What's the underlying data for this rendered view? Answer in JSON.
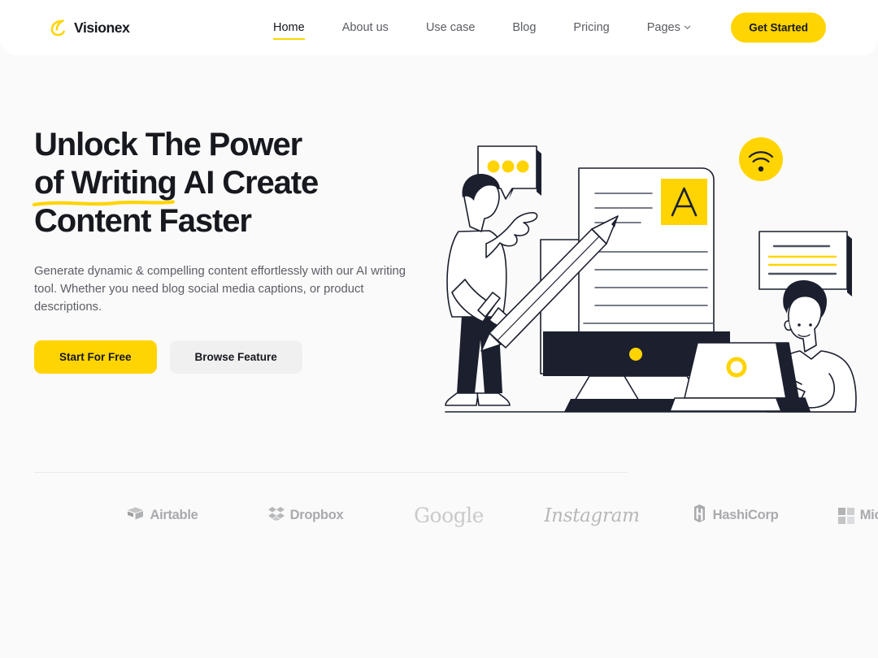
{
  "theme": {
    "accent": "#FFD400",
    "ink": "#17191f",
    "page_bg": "#fafafa",
    "header_bg": "#ffffff",
    "muted_text": "#5c5e66",
    "logo_gray": "#a9aaad"
  },
  "header": {
    "brand_name": "Visionex",
    "brand_icon": "cloud-swoosh-icon",
    "nav": [
      {
        "label": "Home",
        "active": true,
        "has_dropdown": false
      },
      {
        "label": "About us",
        "active": false,
        "has_dropdown": false
      },
      {
        "label": "Use case",
        "active": false,
        "has_dropdown": false
      },
      {
        "label": "Blog",
        "active": false,
        "has_dropdown": false
      },
      {
        "label": "Pricing",
        "active": false,
        "has_dropdown": false
      },
      {
        "label": "Pages",
        "active": false,
        "has_dropdown": true
      }
    ],
    "cta_label": "Get Started"
  },
  "hero": {
    "headline_line1": "Unlock The Power",
    "headline_line2_underlined": "of Writing",
    "headline_line2_rest": " AI Create",
    "headline_line3": "Content Faster",
    "paragraph": "Generate dynamic & compelling content effortlessly with our AI writing tool. Whether you need blog social media captions, or product descriptions.",
    "primary_cta": "Start For Free",
    "secondary_cta": "Browse Feature",
    "illustration": {
      "name": "ai-writing-illustration",
      "elements": [
        "speech-bubble-dots",
        "person-pointing-with-pencil",
        "document-page",
        "letter-a-tile",
        "monitor",
        "wifi-badge",
        "speech-bubble-lines",
        "person-with-laptop"
      ],
      "letter_tile": "A"
    }
  },
  "logos": {
    "items": [
      {
        "name": "Airtable",
        "icon": "airtable-icon"
      },
      {
        "name": "Dropbox",
        "icon": "dropbox-icon"
      },
      {
        "name": "Google",
        "icon": "google-wordmark"
      },
      {
        "name": "Instagram",
        "icon": "instagram-script"
      },
      {
        "name": "HashiCorp",
        "icon": "hashicorp-icon"
      },
      {
        "name": "Microsoft",
        "icon": "microsoft-grid-icon"
      }
    ]
  }
}
